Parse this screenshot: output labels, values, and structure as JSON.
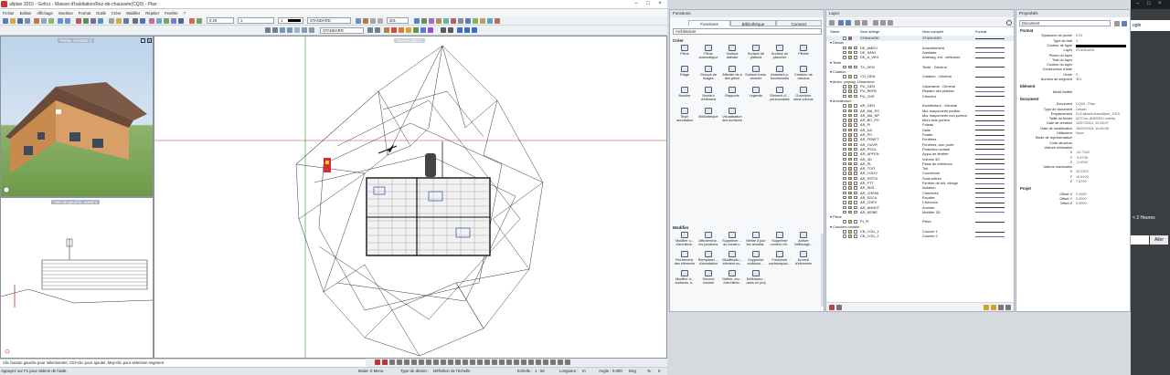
{
  "window": {
    "title": "allplan 2015 - Geltcz - Maison d'habitation/Rez-de-chaussée(CQ0) - Plan",
    "controls": [
      "–",
      "□",
      "×"
    ]
  },
  "menu": [
    "Fichier",
    "Edition",
    "Affichage",
    "Insertion",
    "Format",
    "Outils",
    "Créer",
    "Modifier",
    "Répéter",
    "Fenêtre",
    "?"
  ],
  "toolbar": {
    "pen": "0.25",
    "line": "1",
    "color": "1",
    "style": "STANDARD",
    "scale_field": "301",
    "layer": "STANDARD"
  },
  "viewports": {
    "v1": "Persp. centrale 3",
    "v2": "Vue de gauche, ouest 3",
    "v3": "Vue en plan 2"
  },
  "status": {
    "hint": "Clic bouton gauche pour sélectionner, Ctrl+clic pour ajouter, Maj+clic pour sélection segment",
    "help": "Appuyez sur F1 pour obtenir de l'aide.",
    "mode_label": "Mode :",
    "mode_value": "3 Menu",
    "type_label": "Type de dessin :",
    "type_value": "Définition de l'échelle",
    "scale_label": "Echelle :",
    "scale_value": "1 : 50",
    "length_label": "Longueur :",
    "length_value": "m",
    "angle_label": "Angle :",
    "angle_value": "0.000",
    "deg_label": "Deg",
    "pct_label": "% :",
    "pct_value": "6"
  },
  "functions": {
    "title": "Fonctions",
    "tabs": [
      "Fonctions",
      "Bibliothèque",
      "Connect"
    ],
    "module": "Architecture",
    "create_title": "Créer",
    "create": [
      "Pièce",
      "Pièce automatique",
      "Surface latérale",
      "Surface de plafond",
      "Surface de plancher",
      "Plinthe",
      "Etage",
      "Groupe de étages",
      "Affecter de à des pièce",
      "Surface trans. donnée",
      "Assistant p. fonctionnels",
      "Création de niveaux",
      "Annoter",
      "Numéro d'élément",
      "Rapports",
      "Légende",
      "Elément d'... personnalisé",
      "Ouverture dans volume",
      "Style annotation",
      "Bibliothèque",
      "Visualisation des surfaces"
    ],
    "modify_title": "Modifier",
    "modify": [
      "Modifier u... d'architect..",
      "Afficher/ma.. les jonctions",
      "Supprimer ... de constru..",
      "Mettre à jour les annotat..",
      "Supprimer numéro d'é..",
      "Activer l'affichage...",
      "Rechercher des éléments",
      "Remplacer ... d'annotation",
      "Modificatio... élément nu..",
      "Supprimer surfaces ...",
      "Fusionner surfacespac...",
      "Arrondi d'éléments",
      "Modifier d... surfaces, d..",
      "Second volume",
      "Définir, mo... d'architect..",
      "Définissez... dans un proj"
    ]
  },
  "layers": {
    "title": "Layer",
    "headers": [
      "Statut",
      "Nom abrégé",
      "Nom complet",
      "Format"
    ],
    "groups": [
      {
        "name": "STANDARD",
        "full": "STANDARD",
        "top": true
      },
      {
        "name": "Dessin",
        "items": [
          [
            "DE_AMEU",
            "Ameublement"
          ],
          [
            "DE_SANI",
            "Sanitaire"
          ],
          [
            "DE_A_VEH",
            "Aménag. ext., véhicules"
          ]
        ]
      },
      {
        "name": "Texte",
        "items": [
          [
            "TX_GEN",
            "Texte - Général"
          ]
        ]
      },
      {
        "name": "Cotation",
        "items": [
          [
            "CO_GEN",
            "Cotation - Général"
          ]
        ]
      },
      {
        "name": "Amén. paysag. Urbanisme",
        "items": [
          [
            "PU_GEN",
            "Urbanisme - Général"
          ],
          [
            "PU_REPA",
            "Repaire des plantes"
          ],
          [
            "PU_CHE",
            "Chemins"
          ]
        ]
      },
      {
        "name": "Architecture",
        "items": [
          [
            "AR_GEN",
            "Architecture - Général"
          ],
          [
            "AR_MA_PO",
            "Mur maçonnerie porteur"
          ],
          [
            "AR_MA_NP",
            "Mur maçonnerie non porteur"
          ],
          [
            "AR_BO_PO",
            "Murs bois porteur"
          ],
          [
            "AR_PI",
            "Poteau"
          ],
          [
            "AR_DA",
            "Dalle"
          ],
          [
            "AR_PO",
            "Poutre"
          ],
          [
            "AR_FENET",
            "Fenêtres"
          ],
          [
            "AR_OUVR",
            "Fenêtres, ouv. porte"
          ],
          [
            "AR_PSOL",
            "Protection solaire"
          ],
          [
            "AR_APFEN",
            "Appui de fenêtre"
          ],
          [
            "AR_3D",
            "Volume 3D"
          ],
          [
            "AR_PL",
            "Plans de référence"
          ],
          [
            "AR_TOIT",
            "Toit"
          ],
          [
            "AR_COUV",
            "Couverture"
          ],
          [
            "AR_SSTOI",
            "Sous-toiture"
          ],
          [
            "AR_FTT",
            "Fenêtre de toit, vitrage"
          ],
          [
            "AR_ISOL",
            "Isolation"
          ],
          [
            "AR_CHEMI",
            "Cheminée"
          ],
          [
            "AR_ESCA",
            "Escalier"
          ],
          [
            "AR_CHEV",
            "Chevrons"
          ],
          [
            "AR_ANNOT",
            "Annoter"
          ],
          [
            "AR_MOBE",
            "Mobilier 3D"
          ]
        ]
      },
      {
        "name": "Pièce",
        "items": [
          [
            "PI_PI",
            "Pièce"
          ]
        ]
      },
      {
        "name": "Couches modèle",
        "items": [
          [
            "CB_COU_1",
            "Couche 1"
          ],
          [
            "CB_COU_2",
            "Couche 2"
          ]
        ]
      }
    ]
  },
  "properties": {
    "title": "Propriétés",
    "selector": "Document",
    "format_title": "Format",
    "format": [
      [
        "Epaisseur de plume",
        "0.25"
      ],
      [
        "Type de trait",
        "1"
      ],
      [
        "Couleur de ligne",
        ""
      ],
      [
        "Layer",
        "STANDARD"
      ],
      [
        "Plume du layer",
        ""
      ],
      [
        "Trait du layer",
        ""
      ],
      [
        "Couleur du layer",
        ""
      ],
      [
        "Construction d'aide",
        ""
      ],
      [
        "Ordre",
        "0"
      ],
      [
        "Numéro de segment",
        "301"
      ]
    ],
    "element_title": "Elément",
    "element": [
      [
        "Modif limitée",
        ""
      ]
    ],
    "document_title": "Document",
    "document": [
      [
        "Document",
        "CQ00 - Plan"
      ],
      [
        "Type de document",
        "Dessin"
      ],
      [
        "Emplacement",
        "D:\\Calmet\\Users\\Allan_2015"
      ],
      [
        "Taille du fichier",
        "6270 ko (6420300 octets)"
      ],
      [
        "Date de création",
        "15/07/2014, 10:18:07"
      ],
      [
        "Date de modification",
        "16/09/2015, 10:46:45"
      ],
      [
        "Utilisateur",
        "Nouv"
      ],
      [
        "Mode de représentation",
        ""
      ],
      [
        "Code structure",
        ""
      ],
      [
        "Valeurs minimales",
        ""
      ],
      [
        "X",
        "-10.7342"
      ],
      [
        "Y",
        "-9.8736"
      ],
      [
        "Z",
        "-2.0000"
      ],
      [
        "Valeurs maximales",
        ""
      ],
      [
        "X",
        "10.2322"
      ],
      [
        "Y",
        "10.6103"
      ],
      [
        "Z",
        "7.8790"
      ]
    ],
    "project_title": "Projet",
    "project": [
      [
        "Offset X",
        "0.0000"
      ],
      [
        "Offset Y",
        "0.0000"
      ],
      [
        "Offset Z",
        "0.0000"
      ]
    ]
  },
  "desktop": {
    "top_text": "ogle",
    "mid_text": "< 2 Heures",
    "button": "Aller"
  }
}
